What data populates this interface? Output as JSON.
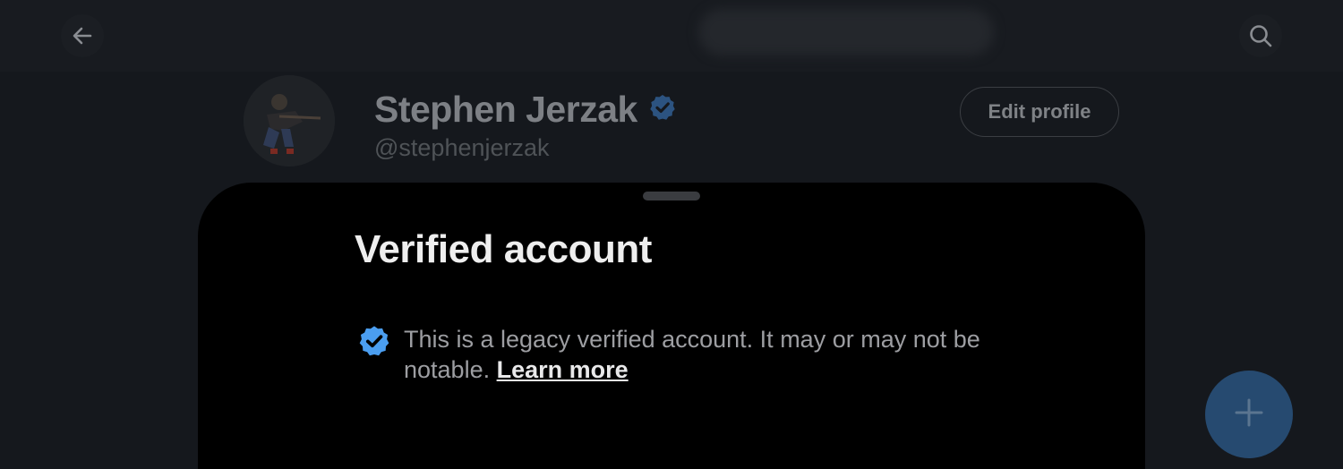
{
  "header": {
    "back_icon": "arrow-left-icon",
    "search_icon": "search-icon"
  },
  "profile": {
    "name": "Stephen Jerzak",
    "handle": "@stephenjerzak",
    "edit_button": "Edit profile",
    "verified_icon": "verified-badge-icon"
  },
  "sheet": {
    "title": "Verified account",
    "description": "This is a legacy verified account. It may or may not be notable.",
    "learn_more": "Learn more"
  },
  "fab": {
    "icon": "plus-icon"
  },
  "colors": {
    "background": "#15181d",
    "sheet_background": "#000000",
    "verified_blue": "#4b9ef0",
    "fab_dimmed": "#264a70"
  }
}
